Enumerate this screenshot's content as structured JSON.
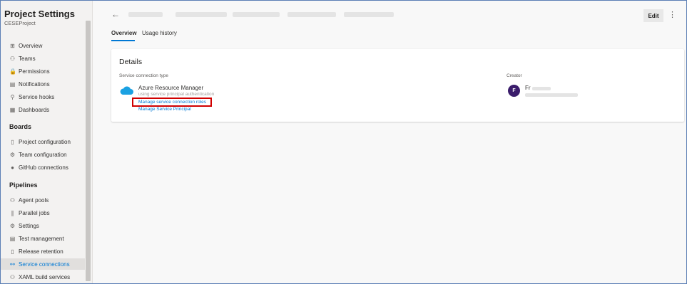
{
  "sidebar": {
    "title": "Project Settings",
    "project": "CESEProject",
    "general_items": [
      {
        "label": "Overview",
        "icon": "overview-icon",
        "glyph": "⊞"
      },
      {
        "label": "Teams",
        "icon": "teams-icon",
        "glyph": "⚇"
      },
      {
        "label": "Permissions",
        "icon": "lock-icon",
        "glyph": "🔒"
      },
      {
        "label": "Notifications",
        "icon": "notification-icon",
        "glyph": "▤"
      },
      {
        "label": "Service hooks",
        "icon": "service-hooks-icon",
        "glyph": "⚲"
      },
      {
        "label": "Dashboards",
        "icon": "dashboard-icon",
        "glyph": "▦"
      }
    ],
    "boards_header": "Boards",
    "boards_items": [
      {
        "label": "Project configuration",
        "icon": "document-icon",
        "glyph": "▯"
      },
      {
        "label": "Team configuration",
        "icon": "team-config-icon",
        "glyph": "⚙"
      },
      {
        "label": "GitHub connections",
        "icon": "github-icon",
        "glyph": "●"
      }
    ],
    "pipelines_header": "Pipelines",
    "pipelines_items": [
      {
        "label": "Agent pools",
        "icon": "agent-pools-icon",
        "glyph": "⚇"
      },
      {
        "label": "Parallel jobs",
        "icon": "parallel-jobs-icon",
        "glyph": "∥"
      },
      {
        "label": "Settings",
        "icon": "settings-gear-icon",
        "glyph": "⚙"
      },
      {
        "label": "Test management",
        "icon": "test-management-icon",
        "glyph": "▤"
      },
      {
        "label": "Release retention",
        "icon": "phone-icon",
        "glyph": "▯"
      },
      {
        "label": "Service connections",
        "icon": "link-icon",
        "glyph": "⚯",
        "active": true
      },
      {
        "label": "XAML build services",
        "icon": "xaml-build-icon",
        "glyph": "⚇"
      }
    ]
  },
  "header": {
    "edit_label": "Edit",
    "more_icon": "more-vertical-icon"
  },
  "tabs": [
    {
      "label": "Overview",
      "active": true
    },
    {
      "label": "Usage history",
      "active": false
    }
  ],
  "details": {
    "title": "Details",
    "service_connection_type_label": "Service connection type",
    "service_name": "Azure Resource Manager",
    "service_desc": "using service principal authentication",
    "link_roles": "Manage service connection roles",
    "link_principal": "Manage Service Principal",
    "creator_label": "Creator",
    "creator_initial": "F",
    "creator_name": "Fr"
  },
  "colors": {
    "accent": "#0078d4",
    "highlight_border": "#d00000",
    "avatar_bg": "#3a1c6b"
  }
}
